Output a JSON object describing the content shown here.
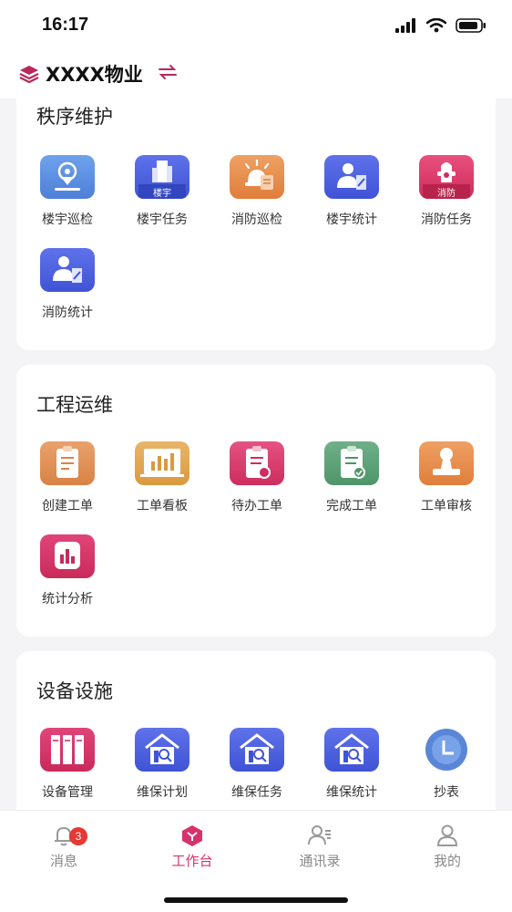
{
  "status": {
    "time": "16:17"
  },
  "header": {
    "title": "XXXX物业"
  },
  "colors": {
    "accent": "#d6336c",
    "blue": "#4a6fe3",
    "orange": "#e88a4a",
    "pink": "#d93a6a",
    "green": "#5a9e72",
    "gold": "#d9a352"
  },
  "sections": [
    {
      "title": "秩序维护",
      "items": [
        {
          "label": "楼宇巡检",
          "icon": "location-pin-icon"
        },
        {
          "label": "楼宇任务",
          "icon": "building-icon",
          "tag": "楼宇"
        },
        {
          "label": "消防巡检",
          "icon": "alarm-light-icon"
        },
        {
          "label": "楼宇统计",
          "icon": "person-report-icon"
        },
        {
          "label": "消防任务",
          "icon": "fire-hydrant-icon",
          "tag": "消防"
        },
        {
          "label": "消防统计",
          "icon": "person-report-icon"
        }
      ]
    },
    {
      "title": "工程运维",
      "items": [
        {
          "label": "创建工单",
          "icon": "clipboard-icon"
        },
        {
          "label": "工单看板",
          "icon": "board-chart-icon"
        },
        {
          "label": "待办工单",
          "icon": "clipboard-pending-icon"
        },
        {
          "label": "完成工单",
          "icon": "clipboard-check-icon"
        },
        {
          "label": "工单审核",
          "icon": "stamp-icon"
        },
        {
          "label": "统计分析",
          "icon": "bar-chart-icon"
        }
      ]
    },
    {
      "title": "设备设施",
      "items": [
        {
          "label": "设备管理",
          "icon": "cabinet-icon"
        },
        {
          "label": "维保计划",
          "icon": "house-search-icon"
        },
        {
          "label": "维保任务",
          "icon": "house-search-icon"
        },
        {
          "label": "维保统计",
          "icon": "house-search-icon"
        },
        {
          "label": "抄表",
          "icon": "meter-clock-icon"
        }
      ]
    }
  ],
  "tabs": [
    {
      "label": "消息",
      "icon": "bell-icon",
      "badge": "3"
    },
    {
      "label": "工作台",
      "icon": "workbench-icon"
    },
    {
      "label": "通讯录",
      "icon": "contacts-icon"
    },
    {
      "label": "我的",
      "icon": "user-icon"
    }
  ]
}
